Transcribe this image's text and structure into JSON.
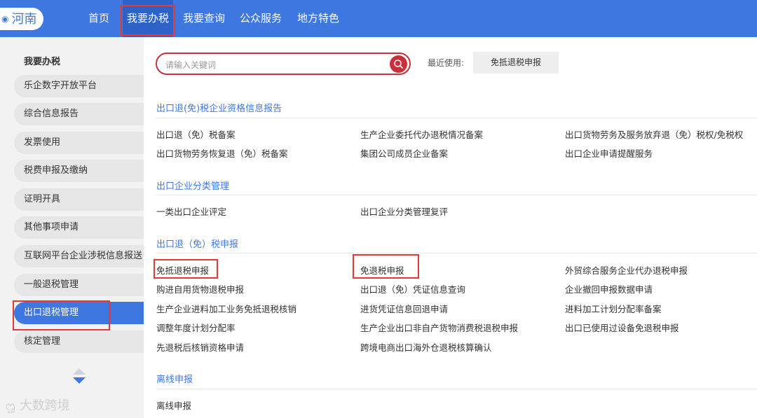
{
  "header": {
    "region": "河南",
    "nav": [
      "首页",
      "我要办税",
      "我要查询",
      "公众服务",
      "地方特色"
    ]
  },
  "sidebar": {
    "title": "我要办税",
    "items": [
      "乐企数字开放平台",
      "综合信息报告",
      "发票使用",
      "税费申报及缴纳",
      "证明开具",
      "其他事项申请",
      "互联网平台企业涉税信息报送",
      "一般退税管理",
      "出口退税管理",
      "核定管理"
    ]
  },
  "search": {
    "placeholder": "请输入关键词",
    "recent_label": "最近使用:",
    "recent_item": "免抵退税申报"
  },
  "sections": [
    {
      "title": "出口退(免)税企业资格信息报告",
      "links": [
        "出口退（免）税备案",
        "生产企业委托代办退税情况备案",
        "出口货物劳务及服务放弃退（免）税权/免税权",
        "出口货物劳务恢复退（免）税备案",
        "集团公司成员企业备案",
        "出口企业申请提醒服务"
      ]
    },
    {
      "title": "出口企业分类管理",
      "links": [
        "一类出口企业评定",
        "出口企业分类管理复评"
      ]
    },
    {
      "title": "出口退（免）税申报",
      "links": [
        "免抵退税申报",
        "免退税申报",
        "外贸综合服务企业代办退税申报",
        "购进自用货物退税申报",
        "出口退（免）凭证信息查询",
        "企业撤回申报数据申请",
        "生产企业进料加工业务免抵退税核销",
        "进货凭证信息回退申请",
        "进料加工计划分配率备案",
        "调整年度计划分配率",
        "生产企业出口非自产货物消费税退税申报",
        "出口已使用过设备免退税申报",
        "先退税后核销资格申请",
        "跨境电商出口海外仓退税核算确认"
      ]
    },
    {
      "title": "离线申报",
      "links": [
        "离线申报"
      ]
    }
  ],
  "watermark": "大数跨境",
  "colors": {
    "brand": "#3f77e0",
    "highlight": "#e53935",
    "search_accent": "#c9303a"
  }
}
